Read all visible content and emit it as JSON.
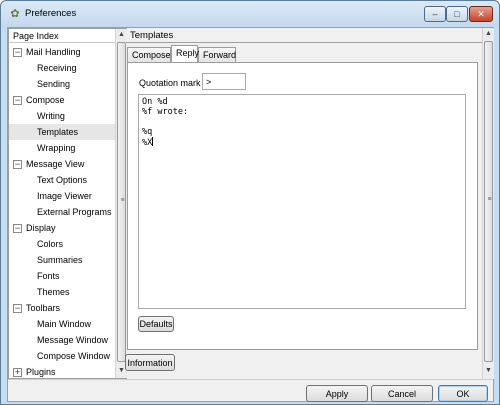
{
  "window": {
    "title": "Preferences",
    "minimize": "–",
    "maximize": "□",
    "close": "✕"
  },
  "sidebar": {
    "header": "Page Index",
    "items": [
      {
        "label": "Mail Handling",
        "level": 0,
        "expander": "−"
      },
      {
        "label": "Receiving",
        "level": 1
      },
      {
        "label": "Sending",
        "level": 1
      },
      {
        "label": "Compose",
        "level": 0,
        "expander": "−"
      },
      {
        "label": "Writing",
        "level": 1
      },
      {
        "label": "Templates",
        "level": 1,
        "selected": true
      },
      {
        "label": "Wrapping",
        "level": 1
      },
      {
        "label": "Message View",
        "level": 0,
        "expander": "−"
      },
      {
        "label": "Text Options",
        "level": 1
      },
      {
        "label": "Image Viewer",
        "level": 1
      },
      {
        "label": "External Programs",
        "level": 1
      },
      {
        "label": "Display",
        "level": 0,
        "expander": "−"
      },
      {
        "label": "Colors",
        "level": 1
      },
      {
        "label": "Summaries",
        "level": 1
      },
      {
        "label": "Fonts",
        "level": 1
      },
      {
        "label": "Themes",
        "level": 1
      },
      {
        "label": "Toolbars",
        "level": 0,
        "expander": "−"
      },
      {
        "label": "Main Window",
        "level": 1
      },
      {
        "label": "Message Window",
        "level": 1
      },
      {
        "label": "Compose Window",
        "level": 1
      },
      {
        "label": "Plugins",
        "level": 0,
        "expander": "+"
      }
    ]
  },
  "main": {
    "section_title": "Templates",
    "tabs": [
      {
        "label": "Compose",
        "active": false
      },
      {
        "label": "Reply",
        "active": true
      },
      {
        "label": "Forward",
        "active": false
      }
    ],
    "quotation_mark_label": "Quotation mark",
    "quotation_mark_value": ">",
    "template_lines": [
      "On %d",
      "%f wrote:",
      "",
      "%q",
      "%X"
    ],
    "defaults_button": "Defaults",
    "information_button": "Information"
  },
  "footer": {
    "apply": "Apply",
    "cancel": "Cancel",
    "ok": "OK"
  }
}
